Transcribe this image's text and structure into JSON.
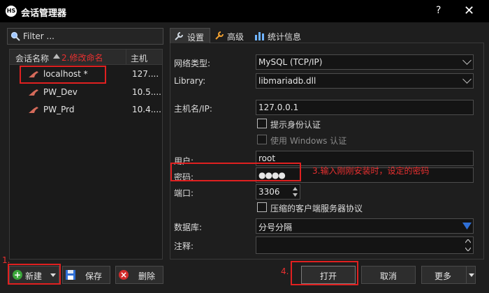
{
  "window": {
    "title": "会话管理器",
    "help": "?",
    "close": "✕"
  },
  "filter": {
    "placeholder": "Filter ..."
  },
  "sessions": {
    "col_name": "会话名称",
    "col_host": "主机",
    "rows": [
      {
        "name": "localhost *",
        "host": "127...."
      },
      {
        "name": "PW_Dev",
        "host": "10.5...."
      },
      {
        "name": "PW_Prd",
        "host": "10.4...."
      }
    ]
  },
  "buttons": {
    "new": "新建",
    "save": "保存",
    "delete": "删除",
    "open": "打开",
    "cancel": "取消",
    "more": "更多"
  },
  "tabs": [
    "设置",
    "高级",
    "统计信息"
  ],
  "form": {
    "network_type_label": "网络类型:",
    "network_type": "MySQL (TCP/IP)",
    "library_label": "Library:",
    "library": "libmariadb.dll",
    "host_label": "主机名/IP:",
    "host": "127.0.0.1",
    "prompt_auth": "提示身份认证",
    "windows_auth": "使用 Windows 认证",
    "user_label": "用户:",
    "user": "root",
    "password_label": "密码:",
    "password": "●●●●",
    "port_label": "端口:",
    "port": "3306",
    "compress": "压缩的客户端服务器协议",
    "database_label": "数据库:",
    "database": "分号分隔",
    "comment_label": "注释:"
  },
  "annotations": {
    "a1": "1.",
    "a2": "2.修改命名",
    "a3": "3.输入刚刚安装时，设定的密码",
    "a4": "4."
  },
  "colors": {
    "annotation": "#e02020",
    "accent": "#2f6fd6"
  }
}
